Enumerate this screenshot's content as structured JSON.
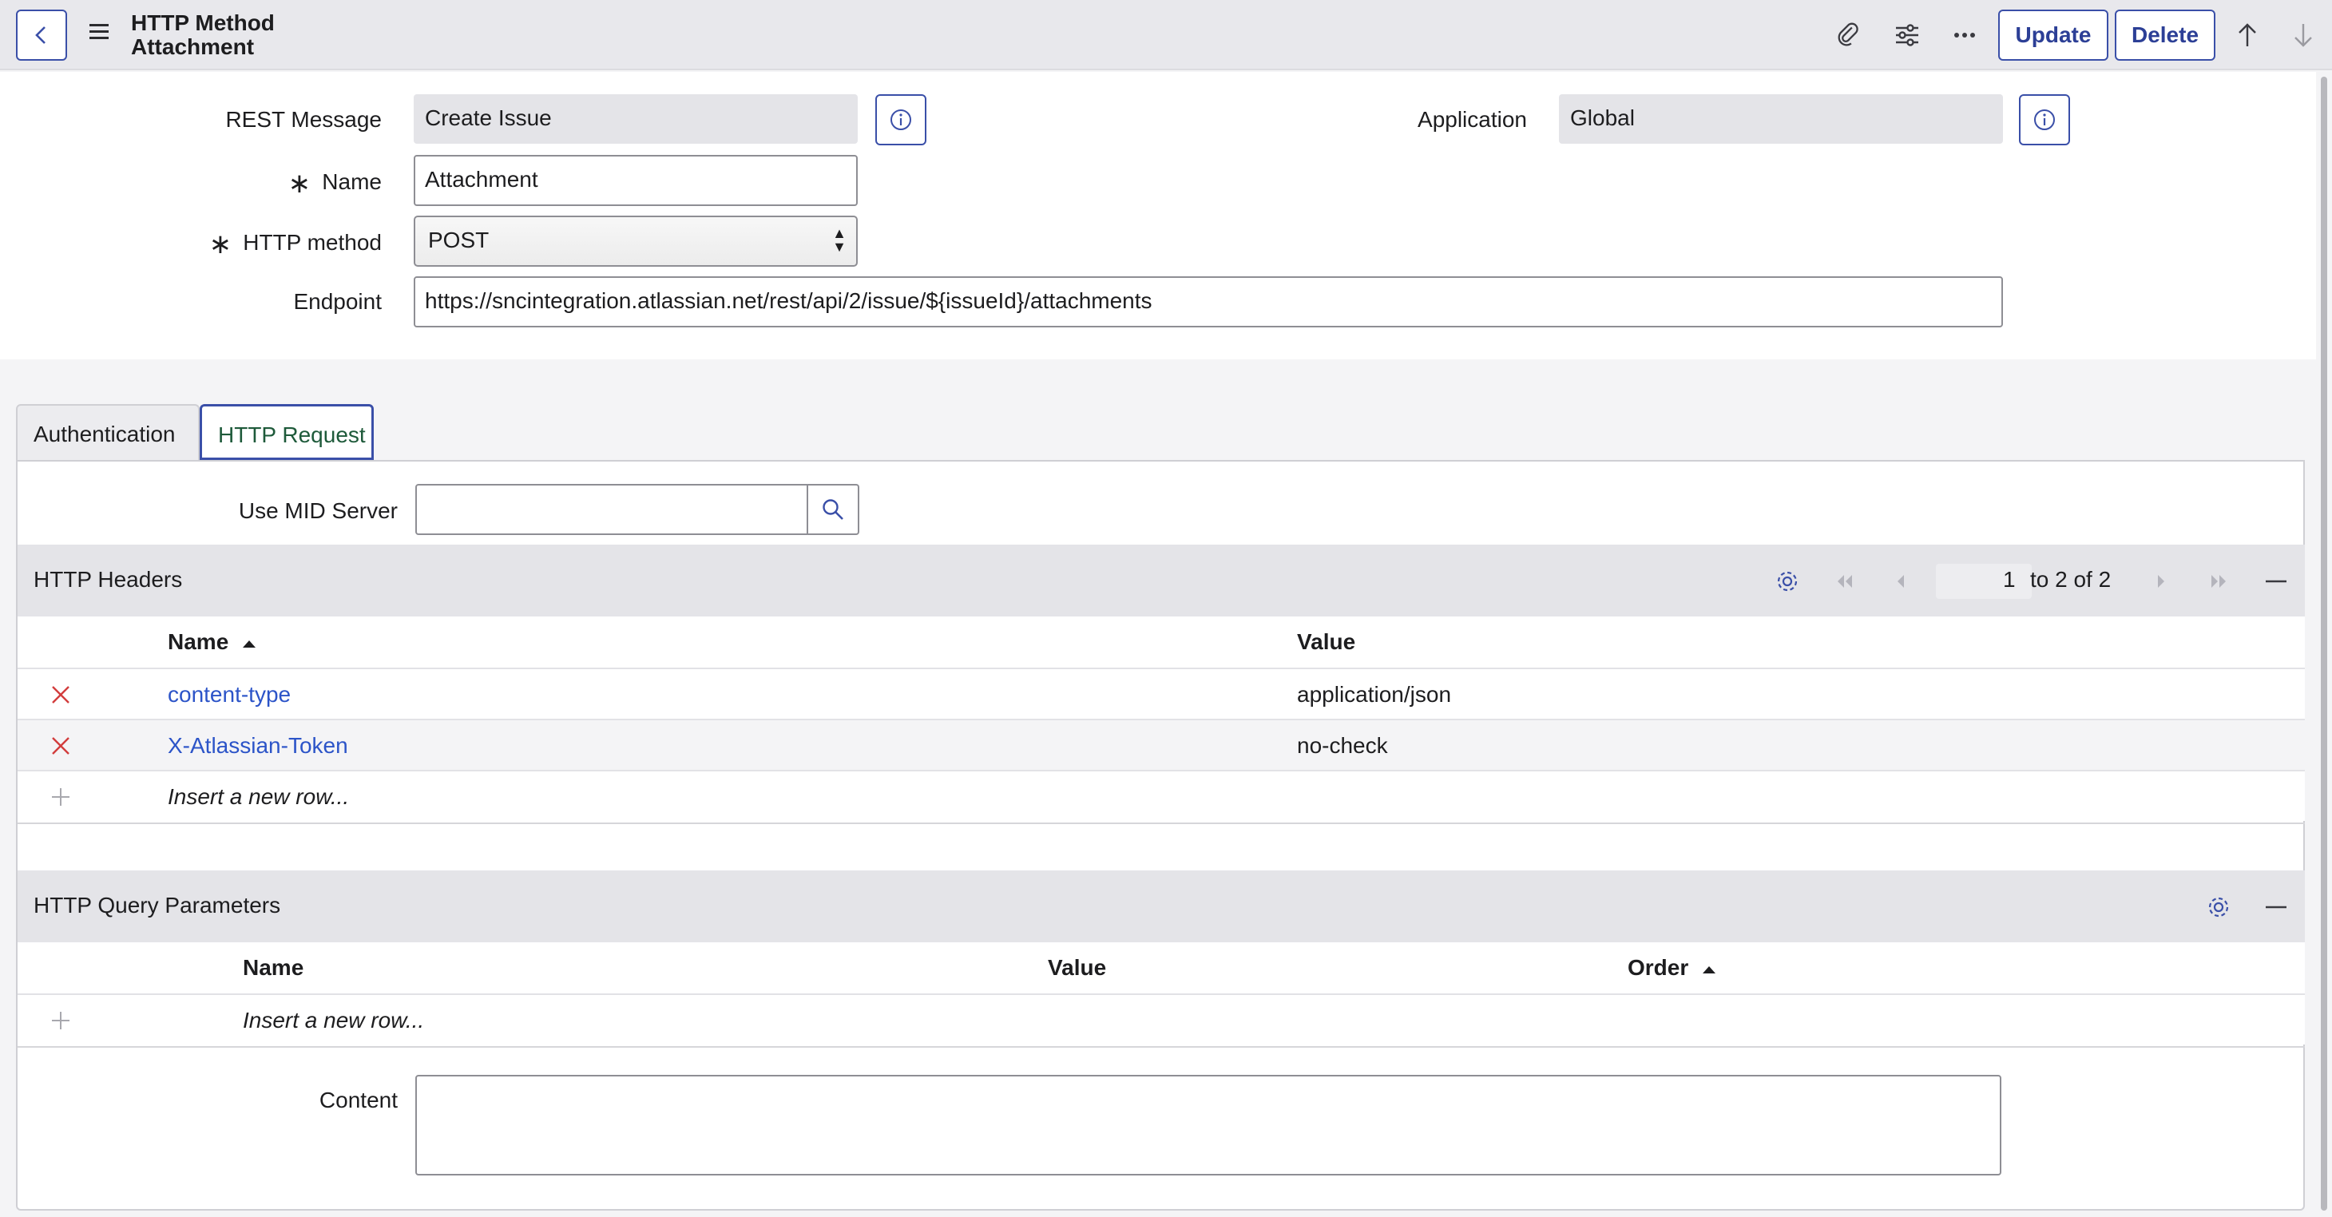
{
  "header": {
    "title_line1": "HTTP Method",
    "title_line2": "Attachment",
    "update_label": "Update",
    "delete_label": "Delete"
  },
  "form": {
    "rest_message_label": "REST Message",
    "rest_message_value": "Create Issue",
    "application_label": "Application",
    "application_value": "Global",
    "required_mark": "∗",
    "name_label": "Name",
    "name_value": "Attachment",
    "http_method_label": "HTTP method",
    "http_method_value": "POST",
    "endpoint_label": "Endpoint",
    "endpoint_value": "https://sncintegration.atlassian.net/rest/api/2/issue/${issueId}/attachments"
  },
  "tabs": [
    {
      "label": "Authentication",
      "active": false
    },
    {
      "label": "HTTP Request",
      "active": true
    }
  ],
  "http_request": {
    "mid_server_label": "Use MID Server",
    "mid_server_value": "",
    "headers": {
      "title": "HTTP Headers",
      "pager_page": "1",
      "pager_text": "to 2 of 2",
      "columns": [
        "Name",
        "Value"
      ],
      "rows": [
        {
          "name": "content-type",
          "value": "application/json"
        },
        {
          "name": "X-Atlassian-Token",
          "value": "no-check"
        }
      ],
      "insert_row": "Insert a new row..."
    },
    "query_params": {
      "title": "HTTP Query Parameters",
      "columns": [
        "Name",
        "Value",
        "Order"
      ],
      "insert_row": "Insert a new row..."
    },
    "content_label": "Content",
    "content_value": ""
  },
  "colors": {
    "accent": "#3a4fa8",
    "link": "#2c54c8",
    "delete": "#d23c3c",
    "header_bg": "#e8e8ec"
  },
  "icons": [
    "back-arrow-icon",
    "hamburger-icon",
    "paperclip-icon",
    "sliders-icon",
    "more-icon",
    "arrow-up-icon",
    "arrow-down-icon",
    "info-icon",
    "search-icon",
    "gear-icon",
    "first-page-icon",
    "prev-page-icon",
    "next-page-icon",
    "last-page-icon",
    "collapse-icon",
    "delete-x-icon",
    "plus-icon",
    "sort-asc-icon"
  ]
}
